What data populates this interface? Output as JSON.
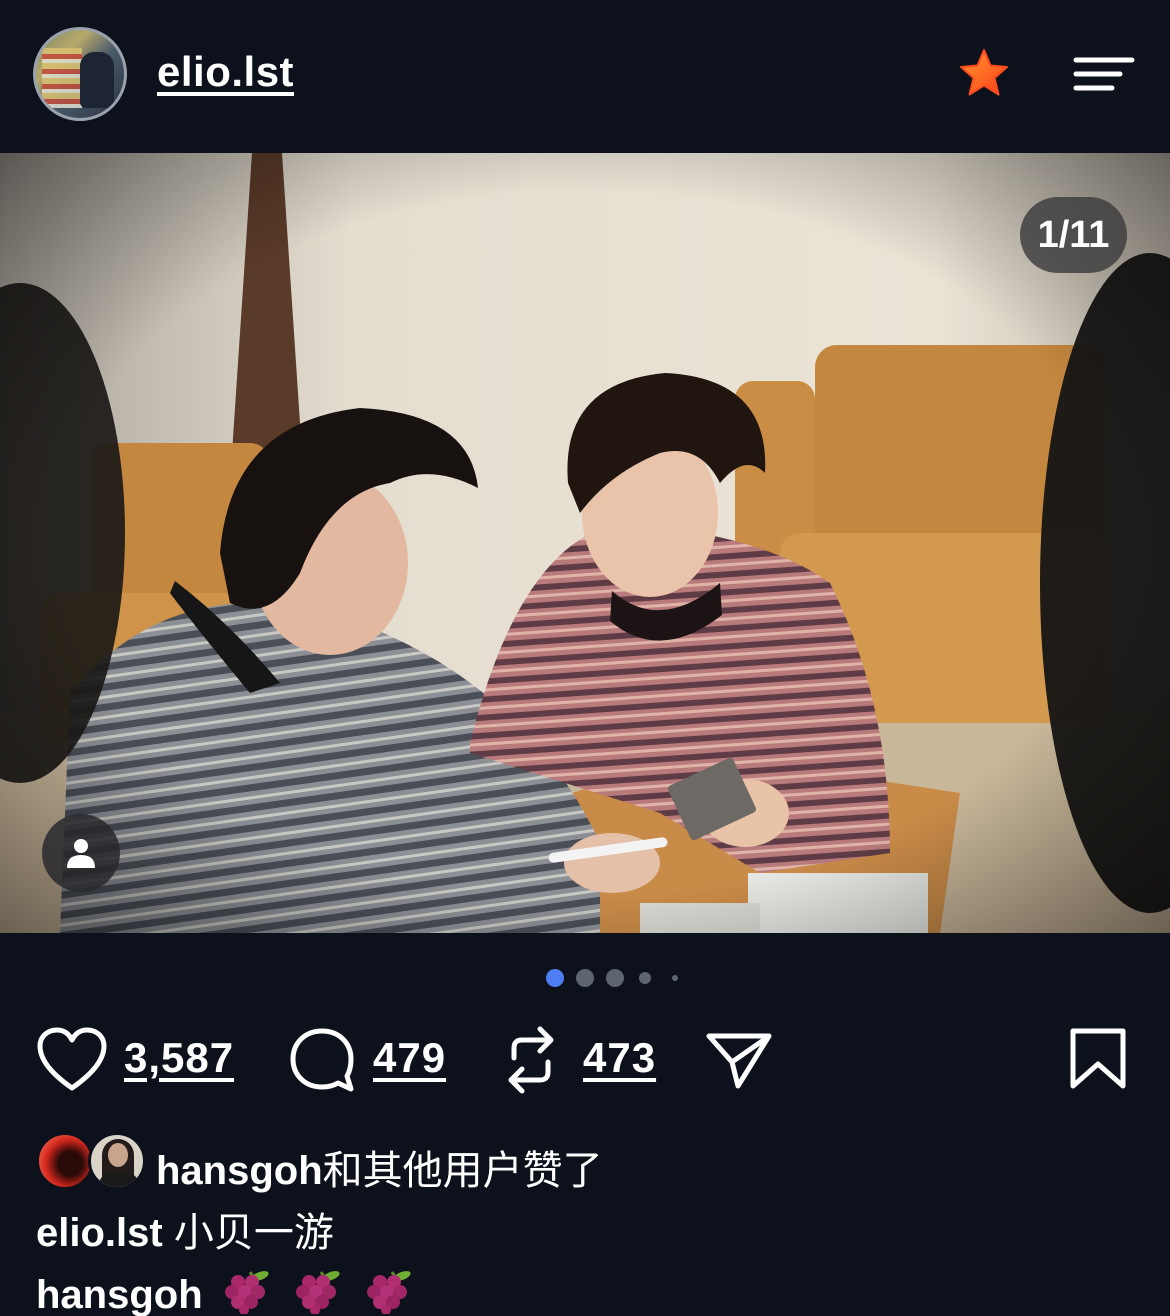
{
  "header": {
    "username": "elio.lst",
    "avatar_icon": "profile-avatar",
    "star_icon": "star-icon",
    "menu_icon": "menu-icon",
    "star_color": "#ff5a1f"
  },
  "photo": {
    "counter": "1/11",
    "tag_icon": "person-icon",
    "carousel_current": 1,
    "carousel_dots": 5
  },
  "actions": {
    "likes": "3,587",
    "comments": "479",
    "reposts": "473",
    "icons": [
      "heart-icon",
      "comment-icon",
      "repost-icon",
      "share-icon",
      "bookmark-icon"
    ]
  },
  "likes_line": {
    "user": "hansgoh",
    "suffix": "和其他用户赞了"
  },
  "caption": {
    "user": "elio.lst",
    "text": "小贝一游"
  },
  "comment": {
    "user": "hansgoh",
    "emoji_icon": "grapes-icon"
  },
  "colors": {
    "background": "#0c111b",
    "active_dot": "#4f7df3",
    "inactive_dot": "#5e6570"
  }
}
